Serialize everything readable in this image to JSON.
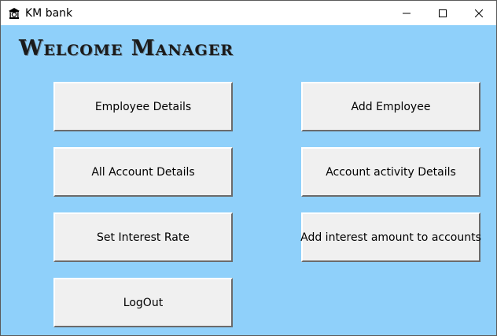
{
  "window": {
    "title": "KM bank",
    "app_icon": "bank-icon",
    "controls": {
      "minimize_icon": "minimize-icon",
      "maximize_icon": "maximize-icon",
      "close_icon": "close-icon"
    }
  },
  "main": {
    "heading": "Welcome Manager",
    "background_color": "#8fd0fa",
    "buttons": [
      {
        "label": "Employee Details"
      },
      {
        "label": "Add Employee"
      },
      {
        "label": "All Account Details"
      },
      {
        "label": "Account activity Details"
      },
      {
        "label": "Set Interest Rate"
      },
      {
        "label": "Add interest amount to accounts"
      },
      {
        "label": "LogOut"
      }
    ]
  }
}
